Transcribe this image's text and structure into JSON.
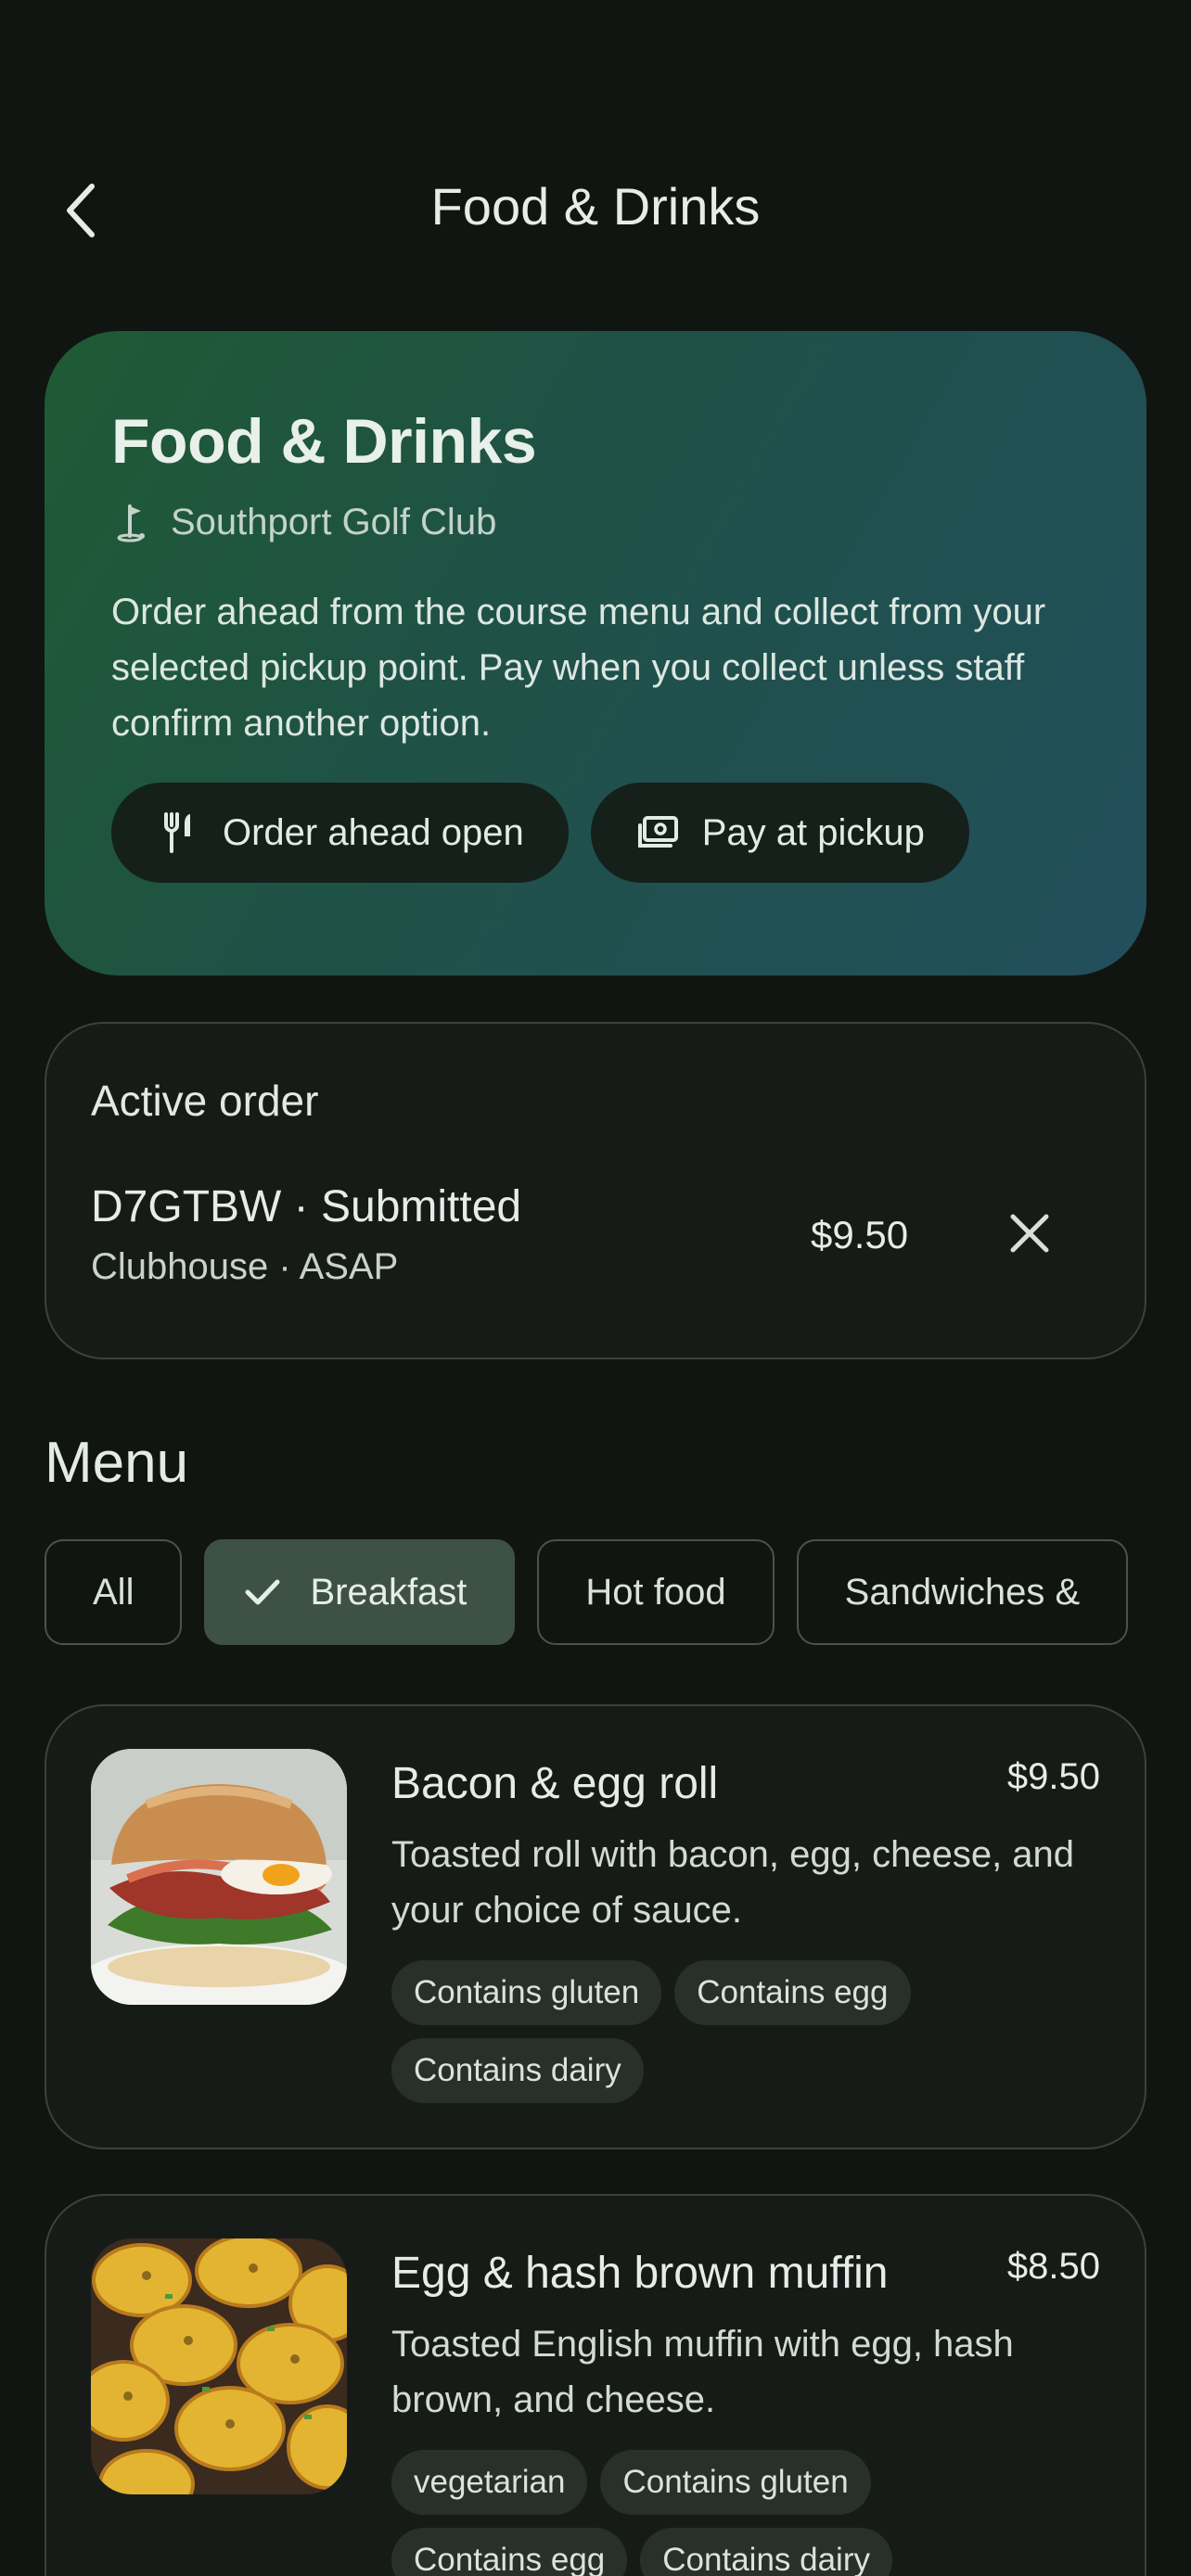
{
  "header": {
    "title": "Food & Drinks"
  },
  "hero": {
    "title": "Food & Drinks",
    "club": "Southport Golf Club",
    "description": "Order ahead from the course menu and collect from your selected pickup point. Pay when you collect unless staff confirm another option.",
    "pills": [
      {
        "label": "Order ahead open",
        "icon": "cutlery-icon"
      },
      {
        "label": "Pay at pickup",
        "icon": "cash-icon"
      }
    ]
  },
  "active_order": {
    "heading": "Active order",
    "id_status": "D7GTBW · Submitted",
    "meta": "Clubhouse · ASAP",
    "price": "$9.50"
  },
  "menu": {
    "heading": "Menu",
    "categories": [
      "All",
      "Breakfast",
      "Hot food",
      "Sandwiches &"
    ],
    "selected_category": "Breakfast",
    "items": [
      {
        "name": "Bacon & egg roll",
        "price": "$9.50",
        "description": "Toasted roll with bacon, egg, cheese, and your choice of sauce.",
        "tags": [
          "Contains gluten",
          "Contains egg",
          "Contains dairy"
        ]
      },
      {
        "name": "Egg & hash brown muffin",
        "price": "$8.50",
        "description": "Toasted English muffin with egg, hash brown, and cheese.",
        "tags": [
          "vegetarian",
          "Contains gluten",
          "Contains egg",
          "Contains dairy"
        ]
      }
    ]
  },
  "colors": {
    "background": "#111512",
    "hero_gradient_start": "#1f5a34",
    "hero_gradient_end": "#224f5c",
    "chip_selected": "#3d5244"
  }
}
